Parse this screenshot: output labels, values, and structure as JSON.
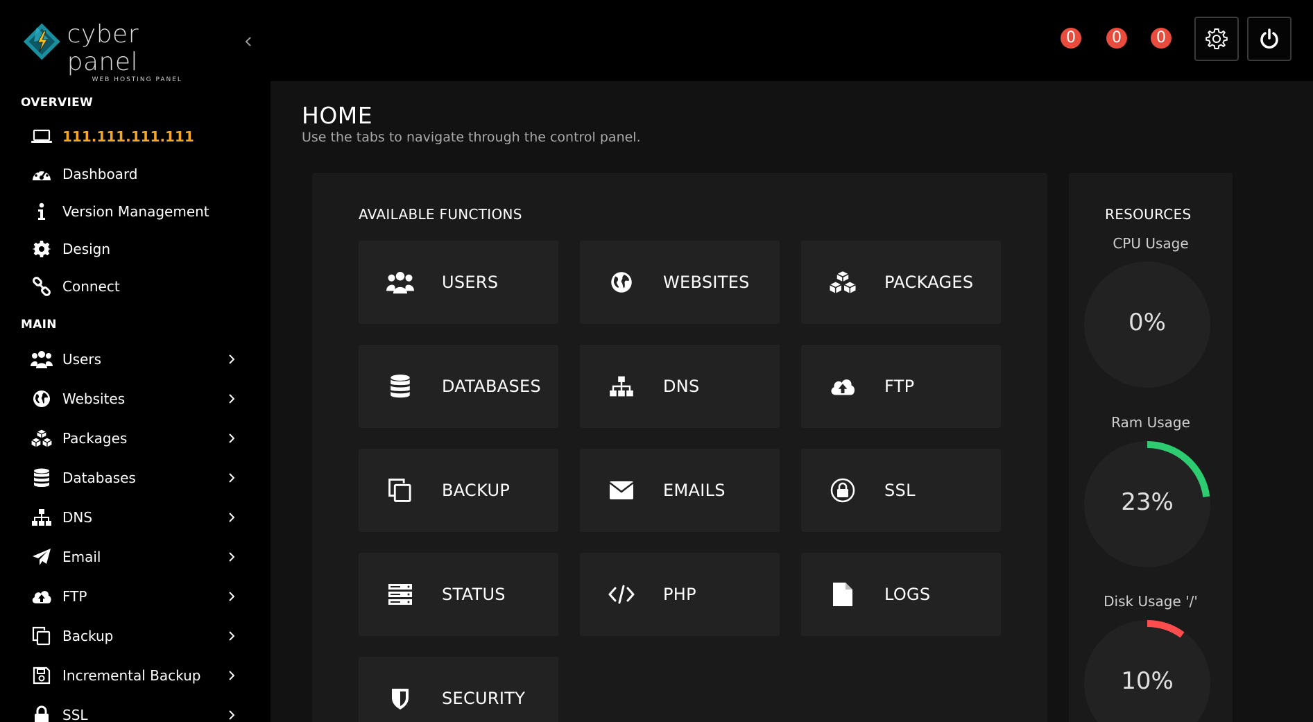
{
  "brand": {
    "name": "cyber panel",
    "tagline": "WEB HOSTING PANEL"
  },
  "notifications": {
    "counts": [
      "0",
      "0",
      "0"
    ],
    "badge_color": "#e74c3c"
  },
  "sidebar": {
    "overview_title": "OVERVIEW",
    "overview_items": [
      {
        "label": "111.111.111.111",
        "icon": "laptop-icon"
      },
      {
        "label": "Dashboard",
        "icon": "dashboard-icon"
      },
      {
        "label": "Version Management",
        "icon": "info-icon"
      },
      {
        "label": "Design",
        "icon": "gear-icon"
      },
      {
        "label": "Connect",
        "icon": "link-icon"
      }
    ],
    "main_title": "MAIN",
    "main_items": [
      {
        "label": "Users",
        "icon": "users-icon"
      },
      {
        "label": "Websites",
        "icon": "globe-icon"
      },
      {
        "label": "Packages",
        "icon": "cubes-icon"
      },
      {
        "label": "Databases",
        "icon": "database-icon"
      },
      {
        "label": "DNS",
        "icon": "sitemap-icon"
      },
      {
        "label": "Email",
        "icon": "paper-plane-icon"
      },
      {
        "label": "FTP",
        "icon": "cloud-upload-icon"
      },
      {
        "label": "Backup",
        "icon": "copy-icon"
      },
      {
        "label": "Incremental Backup",
        "icon": "save-icon"
      },
      {
        "label": "SSL",
        "icon": "lock-icon"
      }
    ],
    "ip_color": "#f5a623"
  },
  "main": {
    "title": "HOME",
    "subtitle": "Use the tabs to navigate through the control panel.",
    "functions_heading": "AVAILABLE FUNCTIONS",
    "tiles": [
      {
        "label": "USERS",
        "icon": "users-icon"
      },
      {
        "label": "WEBSITES",
        "icon": "globe-icon"
      },
      {
        "label": "PACKAGES",
        "icon": "cubes-icon"
      },
      {
        "label": "DATABASES",
        "icon": "database-icon"
      },
      {
        "label": "DNS",
        "icon": "sitemap-icon"
      },
      {
        "label": "FTP",
        "icon": "cloud-upload-icon"
      },
      {
        "label": "BACKUP",
        "icon": "copy-icon"
      },
      {
        "label": "EMAILS",
        "icon": "envelope-icon"
      },
      {
        "label": "SSL",
        "icon": "lock-icon"
      },
      {
        "label": "STATUS",
        "icon": "server-icon"
      },
      {
        "label": "PHP",
        "icon": "code-icon"
      },
      {
        "label": "LOGS",
        "icon": "file-icon"
      },
      {
        "label": "SECURITY",
        "icon": "shield-icon"
      }
    ]
  },
  "resources": {
    "heading": "RESOURCES",
    "gauges": [
      {
        "label": "CPU Usage",
        "value": "0%",
        "fraction": 0,
        "color": "#2ecc71"
      },
      {
        "label": "Ram Usage",
        "value": "23%",
        "fraction": 0.23,
        "color": "#2ecc71"
      },
      {
        "label": "Disk Usage '/'",
        "value": "10%",
        "fraction": 0.1,
        "color": "#ff4d4d"
      }
    ]
  }
}
